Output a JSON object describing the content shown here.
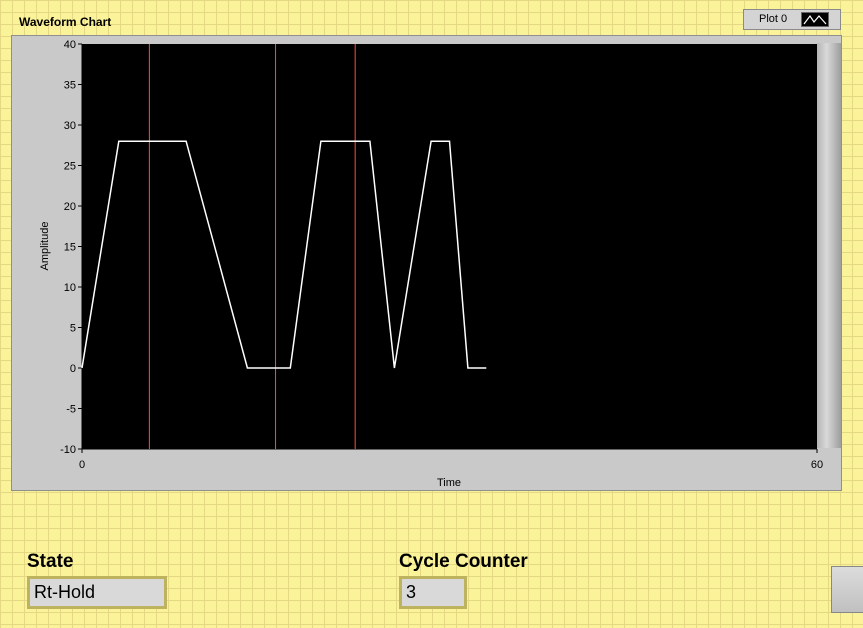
{
  "chart": {
    "title": "Waveform Chart",
    "legend_label": "Plot 0"
  },
  "chart_data": {
    "type": "line",
    "xlabel": "Time",
    "ylabel": "Amplitude",
    "xlim": [
      0,
      60
    ],
    "ylim": [
      -10,
      40
    ],
    "y_ticks": [
      40,
      35,
      30,
      25,
      20,
      15,
      10,
      5,
      0,
      -5,
      -10
    ],
    "x_ticks": [
      0,
      60
    ],
    "series": [
      {
        "color": "#ffffff",
        "x": [
          0,
          3,
          5.5,
          8.5,
          11,
          13.5,
          16,
          17,
          19.5,
          22,
          23.5,
          25.5,
          28.5,
          30,
          31.5,
          33
        ],
        "y": [
          0,
          28,
          28,
          28,
          14,
          0,
          0,
          0,
          28,
          28,
          28,
          0,
          28,
          28,
          0,
          0
        ]
      }
    ],
    "cursors": {
      "color": "#ff4b3e",
      "x": [
        5.5,
        15.8,
        22.3
      ]
    },
    "grid": false,
    "plot_background": "#000000"
  },
  "controls": {
    "state_label": "State",
    "state_value": "Rt-Hold",
    "cycle_label": "Cycle Counter",
    "cycle_value": "3"
  }
}
